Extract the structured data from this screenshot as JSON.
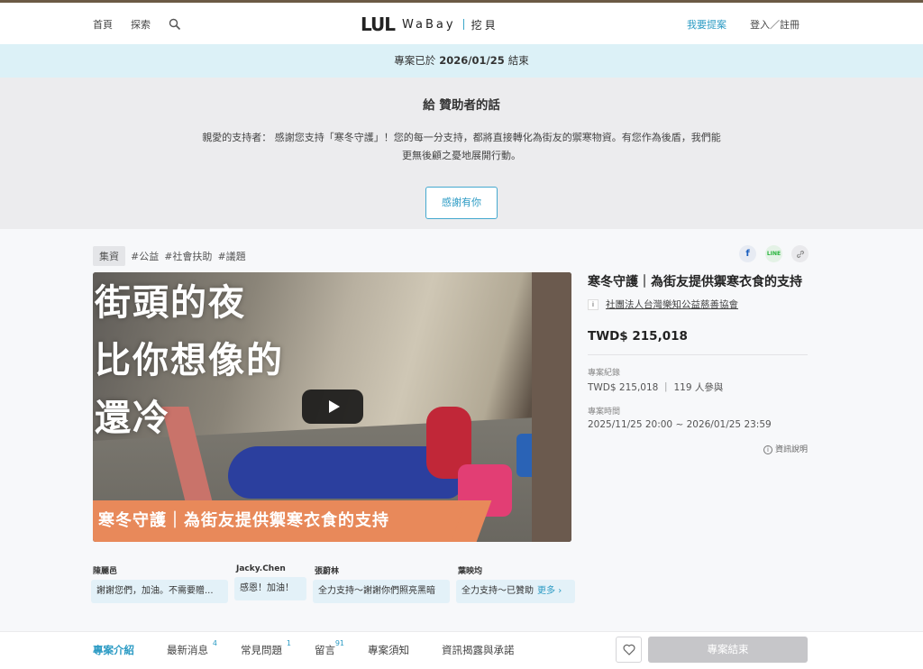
{
  "header": {
    "nav_home": "首頁",
    "nav_explore": "探索",
    "logo_mark": "LUL",
    "logo_text": "WaBay",
    "logo_cn": "挖貝",
    "nav_propose": "我要提案",
    "nav_login": "登入／註冊"
  },
  "banner": {
    "prefix": "專案已於",
    "date": "2026/01/25",
    "suffix": "結束"
  },
  "thanks": {
    "title": "給 贊助者的話",
    "message": "親愛的支持者： 感謝您支持「寒冬守護」！您的每一分支持，都將直接轉化為街友的禦寒物資。有您作為後盾，我們能更無後顧之憂地展開行動。",
    "button": "感謝有你"
  },
  "tags": {
    "type": "集資",
    "items": [
      "#公益",
      "#社會扶助",
      "#議題"
    ]
  },
  "share": {
    "facebook": "f",
    "line": "LINE",
    "link": "🔗"
  },
  "video": {
    "heading_lines": [
      "街頭的夜",
      "比你想像的",
      "還冷"
    ],
    "caption": "寒冬守護｜為街友提供禦寒衣食的支持"
  },
  "project": {
    "title": "寒冬守護｜為街友提供禦寒衣食的支持",
    "org_icon": "i",
    "org_name": "社團法人台灣樂知公益慈善協會",
    "amount": "TWD$ 215,018",
    "record_label": "專案紀錄",
    "record_value": "TWD$ 215,018 ｜ 119 人參與",
    "time_label": "專案時間",
    "time_value": "2025/11/25 20:00 ~ 2026/01/25 23:59",
    "info_note": "資訊說明"
  },
  "comments": [
    {
      "user": "陳麗邑",
      "text": "謝謝您們，加油。不需要贈..."
    },
    {
      "user": "Jacky.Chen",
      "text": "感恩！加油！"
    },
    {
      "user": "張蔚林",
      "text": "全力支持～謝謝你們照亮黑暗"
    },
    {
      "user": "葉映均",
      "text": "全力支持～已贊助"
    }
  ],
  "comments_more": "更多",
  "tabbar": {
    "tabs": [
      {
        "label": "專案介紹",
        "count": ""
      },
      {
        "label": "最新消息",
        "count": "4"
      },
      {
        "label": "常見問題",
        "count": "1"
      },
      {
        "label": "留言",
        "count": "91"
      },
      {
        "label": "專案須知",
        "count": ""
      },
      {
        "label": "資訊揭露與承諾",
        "count": ""
      }
    ],
    "end_button": "專案結束"
  },
  "colors": {
    "accent": "#2c9bc4",
    "banner_bg": "#dcf1f7",
    "thanks_bg": "#ececee",
    "disabled": "#c6c6c9"
  }
}
